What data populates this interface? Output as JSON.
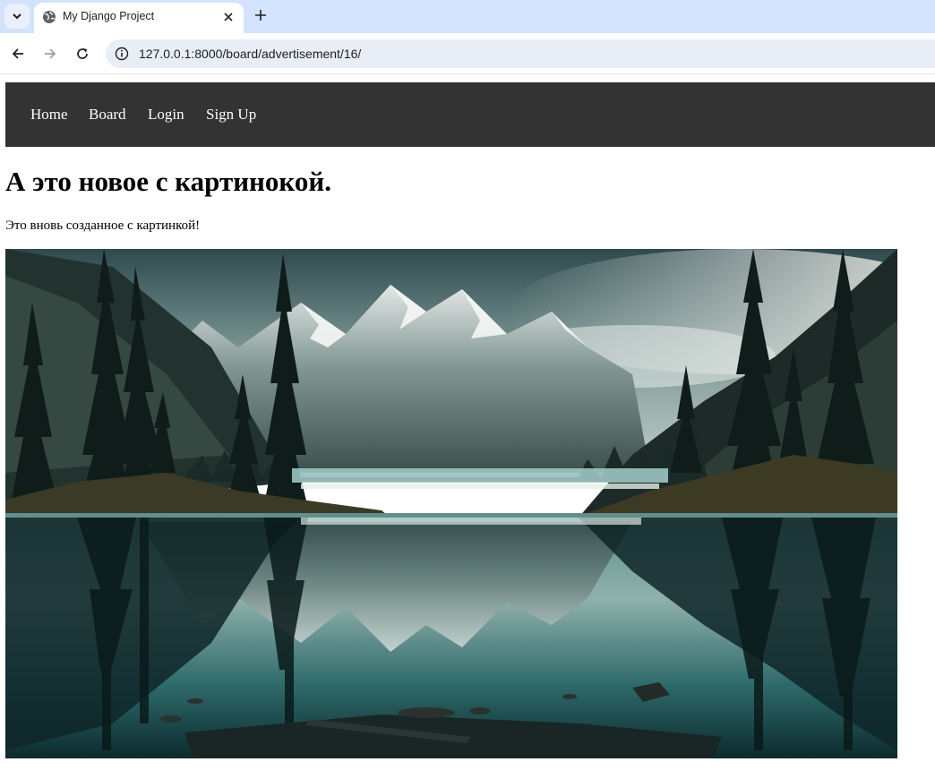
{
  "browser": {
    "tab_title": "My Django Project",
    "url": "127.0.0.1:8000/board/advertisement/16/",
    "icons": [
      "tab-search-icon",
      "globe-icon",
      "close-icon",
      "plus-icon",
      "back-arrow-icon",
      "forward-arrow-icon",
      "reload-icon",
      "info-icon"
    ]
  },
  "navbar": {
    "links": [
      {
        "label": "Home"
      },
      {
        "label": "Board"
      },
      {
        "label": "Login"
      },
      {
        "label": "Sign Up"
      }
    ]
  },
  "advertisement": {
    "title": "А это новое с картинокой.",
    "description": "Это вновь созданное с картинкой!",
    "image": "mountain-lake-photo"
  },
  "colors": {
    "tabstrip": "#d3e3fd",
    "navbar": "#333333",
    "omnibox": "#e9eef6"
  }
}
